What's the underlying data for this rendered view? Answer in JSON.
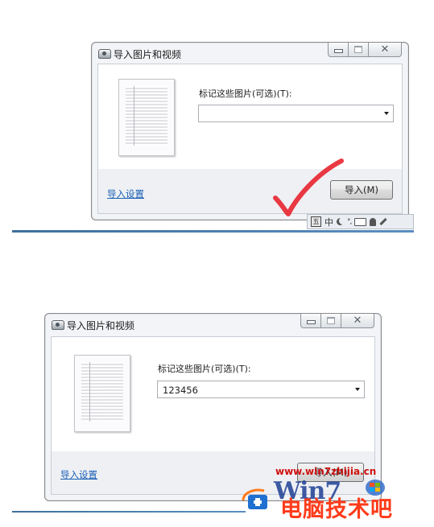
{
  "dialog_top": {
    "title": "导入图片和视频",
    "tag_label": "标记这些图片(可选)(T):",
    "tag_value": "",
    "import_settings_link": "导入设置",
    "import_button": "导入(M)"
  },
  "dialog_bottom": {
    "title": "导入图片和视频",
    "tag_label": "标记这些图片(可选)(T):",
    "tag_value": "123456",
    "import_settings_link": "导入设置",
    "import_button": "导入(M)"
  },
  "ime_toolbar": {
    "mode_char": "中",
    "logo_char": "五"
  },
  "watermark": {
    "url": "www.win7zhijia.cn",
    "brand_mark": "Win7",
    "site_name": "电脑技术吧"
  },
  "colors": {
    "accent_link": "#1a5fb4",
    "checkmark": "#e8242f",
    "watermark_red": "#d01010",
    "watermark_orange": "#ff3b1a",
    "watermark_blue": "#1d3f94"
  }
}
